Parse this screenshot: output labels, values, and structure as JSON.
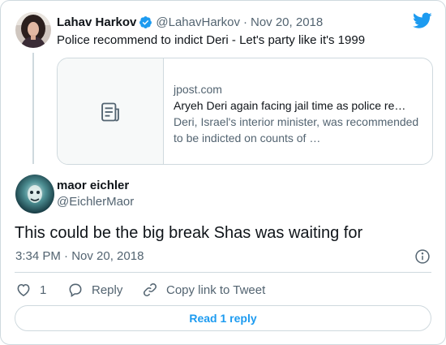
{
  "colors": {
    "accent": "#1d9bf0",
    "muted": "#536471",
    "border": "#cfd9de",
    "text": "#0f1419"
  },
  "quoted_tweet": {
    "author_name": "Lahav Harkov",
    "verified_icon": "verified-badge-icon",
    "handle": "@LahavHarkov",
    "separator": "·",
    "date": "Nov 20, 2018",
    "text": "Police recommend to indict Deri - Let's party like it's 1999",
    "link_card": {
      "icon": "document-icon",
      "domain": "jpost.com",
      "title": "Aryeh Deri again facing jail time as police re…",
      "description": "Deri, Israel's interior minister, was recommended to be indicted on counts of …"
    }
  },
  "logo_icon": "twitter-bird-icon",
  "tweet": {
    "author_name": "maor eichler",
    "handle": "@EichlerMaor",
    "text": "This could be the big break Shas was waiting for",
    "timestamp": "3:34 PM · Nov 20, 2018",
    "info_icon": "info-icon"
  },
  "actions": {
    "like_icon": "heart-icon",
    "like_count": "1",
    "reply_icon": "reply-bubble-icon",
    "reply_label": "Reply",
    "copy_icon": "link-icon",
    "copy_label": "Copy link to Tweet"
  },
  "read_replies_label": "Read 1 reply"
}
